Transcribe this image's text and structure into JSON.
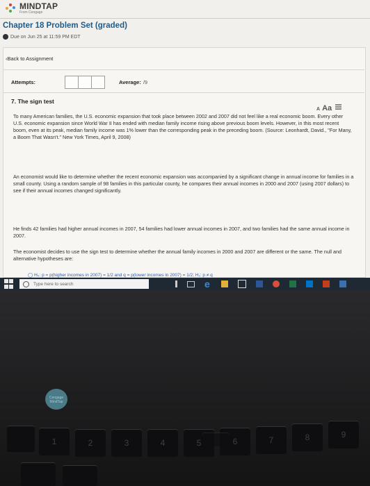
{
  "brand": {
    "name": "MINDTAP",
    "sub": "From Cengage"
  },
  "assignment": {
    "title": "Chapter 18 Problem Set (graded)",
    "due": "Due on Jun 25 at 11:59 PM EDT",
    "back_link": "Back to Assignment"
  },
  "stats": {
    "attempts_label": "Attempts:",
    "average_label": "Average:",
    "average_value": "/9"
  },
  "question": {
    "title": "7. The sign test",
    "font_small": "A",
    "font_large": "Aa",
    "paragraphs": [
      "To many American families, the U.S. economic expansion that took place between 2002 and 2007 did not feel like a real economic boom. Every other U.S. economic expansion since World War II has ended with median family income rising above previous boom levels. However, in this most recent boom, even at its peak, median family income was 1% lower than the corresponding peak in the preceding boom. (Source: Leonhardt, David., \"For Many, a Boom That Wasn't.\" New York Times, April 9, 2008)",
      "An economist would like to determine whether the recent economic expansion was accompanied by a significant change in annual income for families in a small county. Using a random sample of 98 families in this particular county, he compares their annual incomes in 2000 and 2007 (using 2007 dollars) to see if their annual incomes changed significantly.",
      "He finds 42 families had higher annual incomes in 2007, 54 families had lower annual incomes in 2007, and two families had the same annual income in 2007.",
      "The economist decides to use the sign test to determine whether the annual family incomes in 2000 and 2007 are different or the same. The null and alternative hypotheses are:"
    ],
    "hypothesis_option": "H₀: p = p(higher incomes in 2007) = 1/2 and q = p(lower incomes in 2007) = 1/2; H₁: p ≠ q"
  },
  "taskbar": {
    "search_placeholder": "Type here to search",
    "icons": [
      "windows-icon",
      "cortana-circle-icon",
      "mic-icon",
      "task-view-icon",
      "edge-icon",
      "file-explorer-icon",
      "store-icon",
      "word-icon",
      "chrome-icon",
      "excel-icon",
      "outlook-icon",
      "powerpoint-icon",
      "settings-icon"
    ]
  },
  "keyboard": {
    "number_keys": [
      "1",
      "2",
      "3",
      "4",
      "5",
      "6",
      "7",
      "8",
      "9"
    ],
    "sticker": "Cengage MindTap"
  },
  "colors": {
    "title_blue": "#1f5b8a",
    "link_blue": "#2f5db8",
    "taskbar": "#1f2934",
    "page_bg": "#f1f0ec"
  }
}
